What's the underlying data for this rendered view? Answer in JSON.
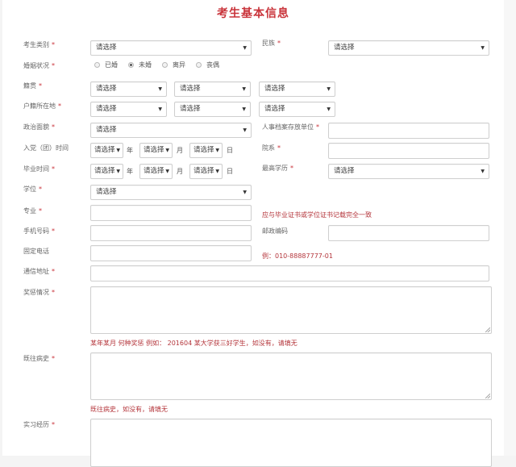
{
  "title": "考生基本信息",
  "placeholder_select": "请选择",
  "required_mark": "*",
  "fields": {
    "candidate_type": {
      "label": "考生类别"
    },
    "ethnicity": {
      "label": "民族"
    },
    "marital_status": {
      "label": "婚姻状况",
      "options": [
        "已婚",
        "未婚",
        "离异",
        "丧偶"
      ],
      "selected": "未婚"
    },
    "native_place": {
      "label": "籍贯"
    },
    "household_registration": {
      "label": "户籍所在地"
    },
    "political_status": {
      "label": "政治面貌"
    },
    "personnel_file_unit": {
      "label": "人事档案存放单位"
    },
    "party_join_date": {
      "label": "入党（团）时间"
    },
    "department": {
      "label": "院系"
    },
    "graduation_date": {
      "label": "毕业时间"
    },
    "highest_education": {
      "label": "最高学历"
    },
    "degree": {
      "label": "学位"
    },
    "major": {
      "label": "专业",
      "hint": "应与毕业证书或学位证书记载完全一致"
    },
    "mobile": {
      "label": "手机号码"
    },
    "postal_code": {
      "label": "邮政编码"
    },
    "landline": {
      "label": "固定电话",
      "hint": "例：010-88887777-01"
    },
    "address": {
      "label": "通信地址"
    },
    "awards": {
      "label": "奖惩情况",
      "hint": "某年某月 何种奖惩 例如： 201604 某大学获三好学生，如没有，请填无"
    },
    "medical_history": {
      "label": "既往病史",
      "hint": "既往病史，如没有，请填无"
    },
    "internship": {
      "label": "实习经历"
    }
  },
  "date_units": {
    "year": "年",
    "month": "月",
    "day": "日"
  },
  "colors": {
    "accent": "#c9333a",
    "hint": "#b4353b"
  }
}
